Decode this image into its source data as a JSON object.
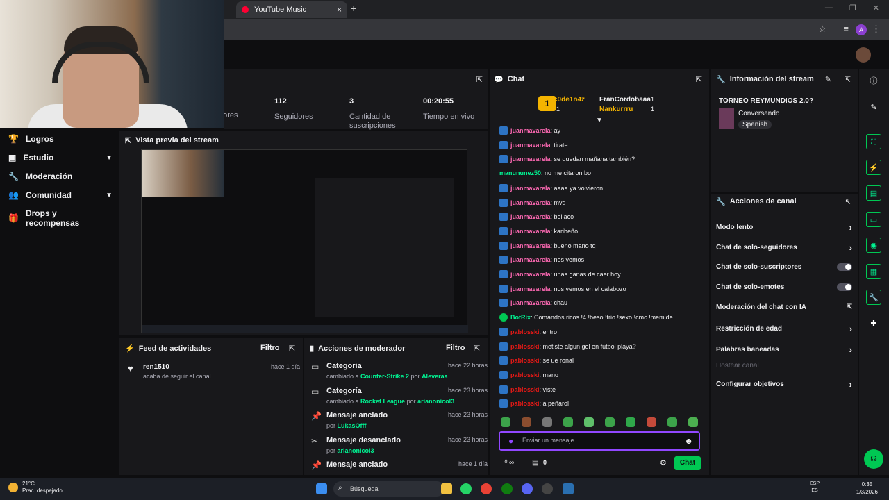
{
  "browser": {
    "tab_title": "YouTube Music",
    "tab_close": "×",
    "new_tab": "+",
    "profile_initial": "A"
  },
  "nav": {
    "items": [
      {
        "label": "Logros",
        "icon": "trophy-icon",
        "chev": ""
      },
      {
        "label": "Estudio",
        "icon": "studio-icon",
        "chev": "⌄"
      },
      {
        "label": "Moderación",
        "icon": "wrench-icon",
        "chev": ""
      },
      {
        "label": "Comunidad",
        "icon": "people-icon",
        "chev": "⌄"
      },
      {
        "label": "Drops y recompensas",
        "icon": "gift-icon",
        "chev": ""
      }
    ]
  },
  "stats": {
    "partial_label": "dores",
    "followers_value": "112",
    "followers_label": "Seguidores",
    "subs_value": "3",
    "subs_label": "Cantidad de suscripciones",
    "live_value": "00:20:55",
    "live_label": "Tiempo en vivo"
  },
  "preview": {
    "title": "Vista previa del stream"
  },
  "feed": {
    "title": "Feed de actividades",
    "filter": "Filtro",
    "items": [
      {
        "user": "ren1510",
        "text": "acaba de seguir el canal",
        "time": "hace 1 día"
      }
    ]
  },
  "mod": {
    "title": "Acciones de moderador",
    "filter": "Filtro",
    "items": [
      {
        "title": "Categoría",
        "pre": "cambiado a ",
        "target": "Counter-Strike 2",
        "mid": " por ",
        "user": "Aleveraa",
        "time": "hace 22 horas"
      },
      {
        "title": "Categoría",
        "pre": "cambiado a ",
        "target": "Rocket League",
        "mid": " por ",
        "user": "arianonicol3",
        "time": "hace 23 horas"
      },
      {
        "title": "Mensaje anclado",
        "pre": "por ",
        "target": "LukasOfff",
        "mid": "",
        "user": "",
        "time": "hace 23 horas"
      },
      {
        "title": "Mensaje desanclado",
        "pre": "por ",
        "target": "arianonicol3",
        "mid": "",
        "user": "",
        "time": "hace 23 horas"
      },
      {
        "title": "Mensaje anclado",
        "pre": "",
        "target": "",
        "mid": "",
        "user": "",
        "time": "hace 1 día"
      }
    ]
  },
  "chat": {
    "title": "Chat",
    "top": [
      {
        "rank": "1",
        "name": "c0de1n4z",
        "count": "1"
      },
      {
        "name": "FranCordobaaa",
        "count": "1"
      },
      {
        "name": "Nankurrru",
        "count": "1"
      }
    ],
    "messages": [
      {
        "user": "juanmavarela",
        "text": ": ay",
        "color": "#ff69b4",
        "badge": true
      },
      {
        "user": "juanmavarela",
        "text": ": tirate",
        "color": "#ff69b4",
        "badge": true
      },
      {
        "user": "juanmavarela",
        "text": ": se quedan mañana también?",
        "color": "#ff69b4",
        "badge": true
      },
      {
        "user": "manununez50",
        "text": ": no me citaron bo",
        "color": "#00f593",
        "badge": false
      },
      {
        "user": "juanmavarela",
        "text": ": aaaa ya volvieron",
        "color": "#ff69b4",
        "badge": true
      },
      {
        "user": "juanmavarela",
        "text": ": mvd",
        "color": "#ff69b4",
        "badge": true
      },
      {
        "user": "juanmavarela",
        "text": ": bellaco",
        "color": "#ff69b4",
        "badge": true
      },
      {
        "user": "juanmavarela",
        "text": ": karibeño",
        "color": "#ff69b4",
        "badge": true
      },
      {
        "user": "juanmavarela",
        "text": ": bueno mano tq",
        "color": "#ff69b4",
        "badge": true
      },
      {
        "user": "juanmavarela",
        "text": ": nos vemos",
        "color": "#ff69b4",
        "badge": true
      },
      {
        "user": "juanmavarela",
        "text": ": unas ganas de caer hoy",
        "color": "#ff69b4",
        "badge": true
      },
      {
        "user": "juanmavarela",
        "text": ": nos vemos en el calabozo",
        "color": "#ff69b4",
        "badge": true
      },
      {
        "user": "juanmavarela",
        "text": ": chau",
        "color": "#ff69b4",
        "badge": true
      },
      {
        "user": "BotRix",
        "text": ": Comandos ricos !4 !beso !trio !sexo !cmc !memide",
        "color": "#00f593",
        "badge": true
      },
      {
        "user": "pablosski",
        "text": ": entro",
        "color": "#e91916",
        "badge": true
      },
      {
        "user": "pablosski",
        "text": ": metiste algun gol en futbol playa?",
        "color": "#e91916",
        "badge": true
      },
      {
        "user": "pablosski",
        "text": ": se ue ronal",
        "color": "#e91916",
        "badge": true
      },
      {
        "user": "pablosski",
        "text": ": mano",
        "color": "#e91916",
        "badge": true
      },
      {
        "user": "pablosski",
        "text": ": viste",
        "color": "#e91916",
        "badge": true
      },
      {
        "user": "pablosski",
        "text": ": a peñarol",
        "color": "#e91916",
        "badge": true
      }
    ],
    "input_placeholder": "Enviar un mensaje",
    "points": "0",
    "send": "Chat"
  },
  "info": {
    "title": "Información del stream",
    "stream_title": "TORNEO REYMUNDIOS 2.0?",
    "category": "Conversando",
    "tag": "Spanish"
  },
  "actions": {
    "title": "Acciones de canal",
    "items": [
      {
        "label": "Modo lento",
        "ctrl": "arrow"
      },
      {
        "label": "Chat de solo-seguidores",
        "ctrl": "arrow"
      },
      {
        "label": "Chat de solo-suscriptores",
        "ctrl": "toggle"
      },
      {
        "label": "Chat de solo-emotes",
        "ctrl": "toggle"
      },
      {
        "label": "Moderación del chat con IA",
        "ctrl": "ext"
      },
      {
        "label": "Restricción de edad",
        "ctrl": "arrow"
      },
      {
        "label": "Palabras baneadas",
        "ctrl": "arrow"
      },
      {
        "label": "Hostear canal",
        "ctrl": "none"
      },
      {
        "label": "Configurar objetivos",
        "ctrl": "arrow"
      }
    ]
  },
  "taskbar": {
    "temp": "21°C",
    "weather": "Prac. despejado",
    "search": "Búsqueda",
    "lang1": "ESP",
    "lang2": "ES",
    "time": "0:35",
    "date": "1/3/2026"
  },
  "colors": {
    "accent": "#9147ff",
    "green": "#00f593",
    "bg": "#0e0e10",
    "panel": "#18181b"
  }
}
